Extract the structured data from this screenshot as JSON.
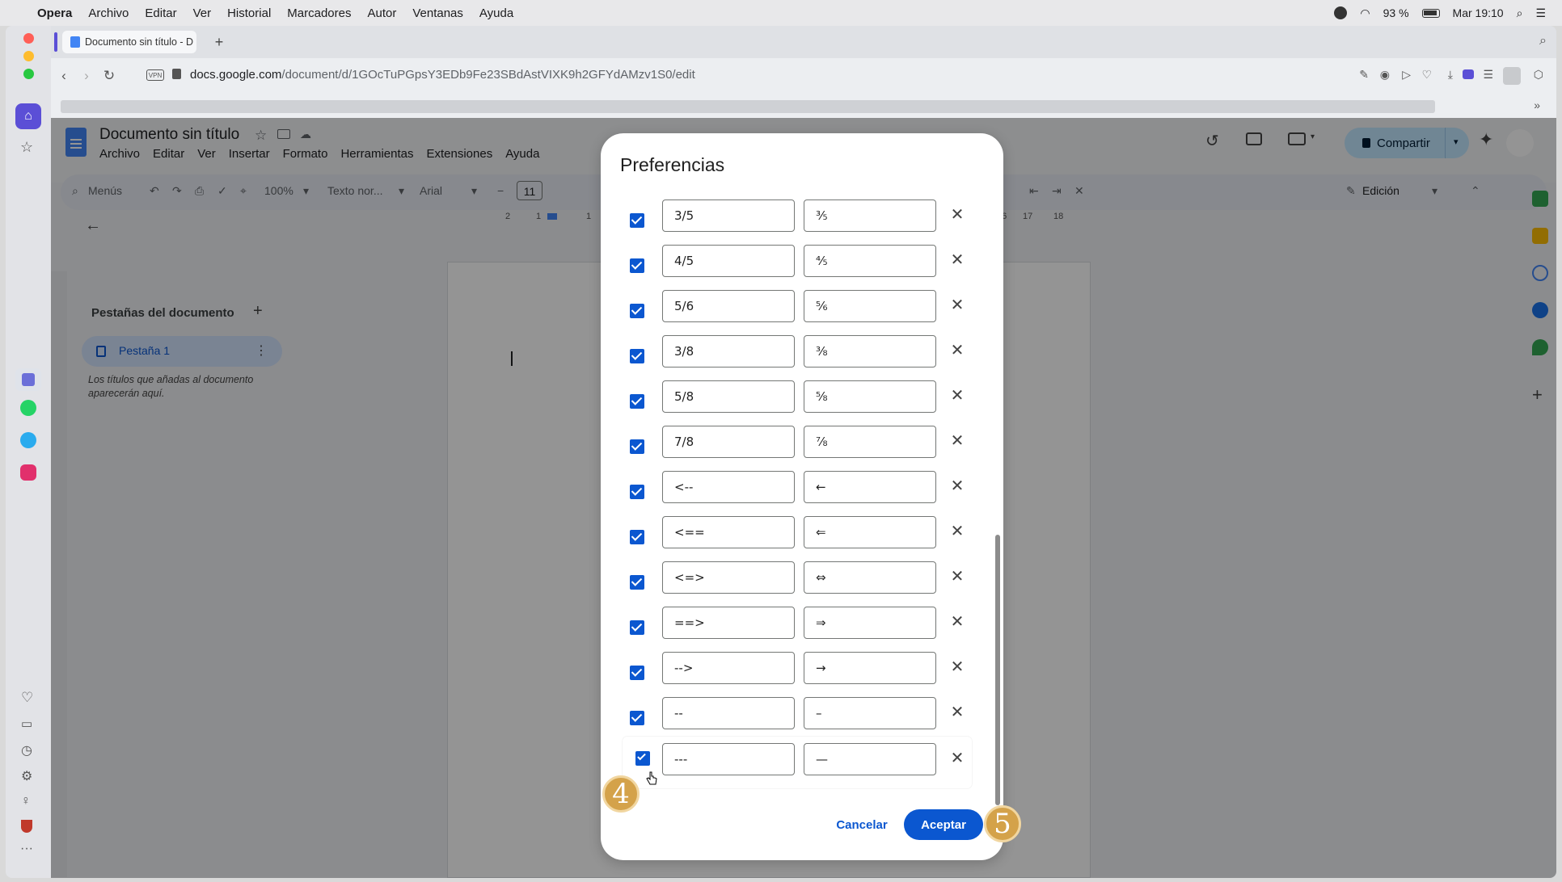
{
  "menubar": {
    "app": "Opera",
    "items": [
      "Archivo",
      "Editar",
      "Ver",
      "Historial",
      "Marcadores",
      "Autor",
      "Ventanas",
      "Ayuda"
    ],
    "battery": "93 %",
    "clock": "Mar 19:10"
  },
  "browser": {
    "tab_title": "Documento sin título - D",
    "url_host": "docs.google.com",
    "url_path": "/document/d/1GOcTuPGpsY3EDb9Fe23SBdAstVIXK9h2GFYdAMzv1S0/edit"
  },
  "docs": {
    "title": "Documento sin título",
    "menu": [
      "Archivo",
      "Editar",
      "Ver",
      "Insertar",
      "Formato",
      "Herramientas",
      "Extensiones",
      "Ayuda"
    ],
    "toolbar": {
      "search": "Menús",
      "zoom": "100%",
      "style": "Texto nor...",
      "font": "Arial",
      "font_size": "11",
      "mode": "Edición"
    },
    "share_label": "Compartir",
    "ruler_marks": [
      "2",
      "1",
      "1",
      "2",
      "16",
      "17",
      "18"
    ],
    "sidebar": {
      "heading": "Pestañas del documento",
      "tab_label": "Pestaña 1",
      "hint": "Los títulos que añadas al documento aparecerán aquí."
    }
  },
  "dialog": {
    "title": "Preferencias",
    "rows": [
      {
        "from": "3/5",
        "to": "⅗"
      },
      {
        "from": "4/5",
        "to": "⅘"
      },
      {
        "from": "5/6",
        "to": "⅚"
      },
      {
        "from": "3/8",
        "to": "⅜"
      },
      {
        "from": "5/8",
        "to": "⅝"
      },
      {
        "from": "7/8",
        "to": "⅞"
      },
      {
        "from": "<--",
        "to": "←"
      },
      {
        "from": "<==",
        "to": "⇐"
      },
      {
        "from": "<=>",
        "to": "⇔"
      },
      {
        "from": "==>",
        "to": "⇒"
      },
      {
        "from": "-->",
        "to": "→"
      },
      {
        "from": "--",
        "to": "–"
      },
      {
        "from": "---",
        "to": "—"
      }
    ],
    "cancel_label": "Cancelar",
    "accept_label": "Aceptar"
  },
  "annotations": {
    "step_a": "4",
    "step_b": "5"
  },
  "colors": {
    "accent": "#0b57d0",
    "step_badge": "#d4a24a"
  }
}
